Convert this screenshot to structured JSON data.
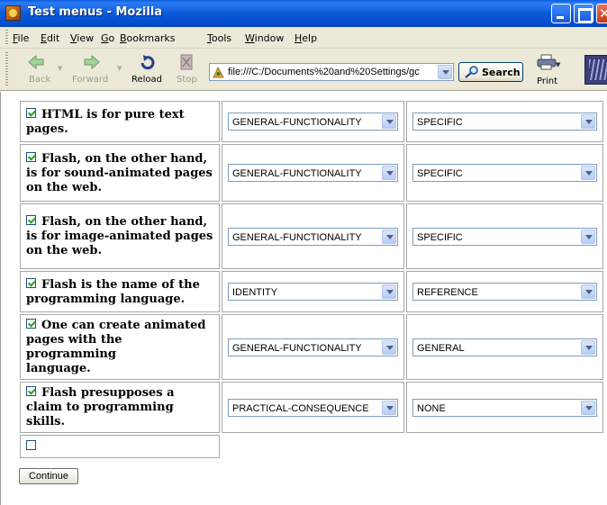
{
  "window": {
    "title": "Test menus - Mozilla"
  },
  "menubar": {
    "items": [
      "File",
      "Edit",
      "View",
      "Go",
      "Bookmarks",
      "Tools",
      "Window",
      "Help"
    ]
  },
  "toolbar": {
    "back_label": "Back",
    "forward_label": "Forward",
    "reload_label": "Reload",
    "stop_label": "Stop",
    "url": "file:///C:/Documents%20and%20Settings/gc",
    "search_label": "Search",
    "print_label": "Print"
  },
  "rows": [
    {
      "checked": true,
      "lines": [
        "HTML is for pure text",
        "pages."
      ],
      "select1": "GENERAL-FUNCTIONALITY",
      "select2": "SPECIFIC"
    },
    {
      "checked": true,
      "lines": [
        "Flash, on the other hand,",
        "is for sound-animated pages",
        "on the web."
      ],
      "select1": "GENERAL-FUNCTIONALITY",
      "select2": "SPECIFIC"
    },
    {
      "checked": true,
      "lines": [
        "Flash, on the other hand,",
        "is for image-animated pages",
        "on the web."
      ],
      "select1": "GENERAL-FUNCTIONALITY",
      "select2": "SPECIFIC"
    },
    {
      "checked": true,
      "lines": [
        "Flash is the name of the",
        "programming language."
      ],
      "select1": "IDENTITY",
      "select2": "REFERENCE"
    },
    {
      "checked": true,
      "lines": [
        "One can create animated",
        "pages with the programming",
        "language."
      ],
      "select1": "GENERAL-FUNCTIONALITY",
      "select2": "GENERAL"
    },
    {
      "checked": true,
      "lines": [
        "Flash presupposes a",
        "claim to programming skills."
      ],
      "select1": "PRACTICAL-CONSEQUENCE",
      "select2": "NONE"
    }
  ],
  "empty_row": {
    "checked": false
  },
  "continue_label": "Continue",
  "colors": {
    "titlebar": "#0a5ad8",
    "chrome": "#ece9d8",
    "checkmark": "#21a121",
    "field_border": "#7f9db9"
  }
}
